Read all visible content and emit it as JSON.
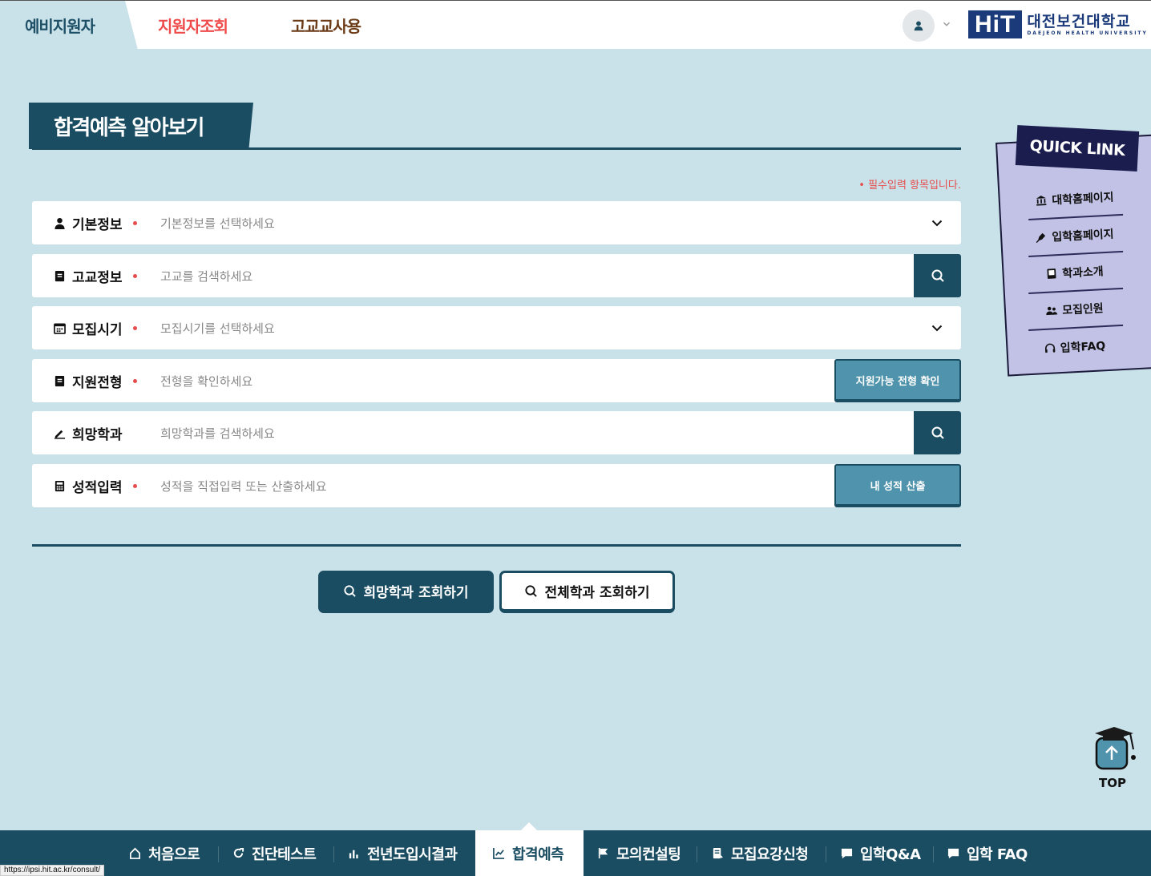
{
  "topnav": {
    "tabs": [
      {
        "label": "예비지원자"
      },
      {
        "label": "지원자조회"
      },
      {
        "label": "고교교사용"
      }
    ],
    "logo": {
      "box": "HiT",
      "ko": "대전보건대학교",
      "en": "DAEJEON HEALTH UNIVERSITY"
    }
  },
  "page": {
    "title": "합격예측 알아보기",
    "required_note": "• 필수입력 항목입니다."
  },
  "form": {
    "rows": [
      {
        "label": "기본정보",
        "placeholder": "기본정보를 선택하세요",
        "icon": "user-icon",
        "required": true
      },
      {
        "label": "고교정보",
        "placeholder": "고교를 검색하세요",
        "icon": "book-icon",
        "required": true
      },
      {
        "label": "모집시기",
        "placeholder": "모집시기를 선택하세요",
        "icon": "calendar-icon",
        "required": true
      },
      {
        "label": "지원전형",
        "placeholder": "전형을 확인하세요",
        "icon": "book-icon",
        "required": true,
        "button": "지원가능 전형 확인"
      },
      {
        "label": "희망학과",
        "placeholder": "희망학과를 검색하세요",
        "icon": "pencil-icon",
        "required": false
      },
      {
        "label": "성적입력",
        "placeholder": "성적을 직접입력 또는 산출하세요",
        "icon": "calculator-icon",
        "required": true,
        "button": "내 성적 산출"
      }
    ]
  },
  "actions": {
    "search_desired": "희망학과 조회하기",
    "search_all": "전체학과 조회하기"
  },
  "quicklink": {
    "title": "QUICK LINK",
    "items": [
      {
        "label": "대학홈페이지",
        "icon": "university-icon"
      },
      {
        "label": "입학홈페이지",
        "icon": "pen-nib-icon"
      },
      {
        "label": "학과소개",
        "icon": "book-icon"
      },
      {
        "label": "모집인원",
        "icon": "users-icon"
      },
      {
        "label": "입학FAQ",
        "icon": "headset-icon"
      }
    ]
  },
  "top_button": {
    "label": "TOP"
  },
  "bottomnav": {
    "items": [
      {
        "label": "처음으로",
        "icon": "home-icon"
      },
      {
        "label": "진단테스트",
        "icon": "refresh-icon"
      },
      {
        "label": "전년도입시결과",
        "icon": "bar-chart-icon"
      },
      {
        "label": "합격예측",
        "icon": "line-chart-icon",
        "active": true
      },
      {
        "label": "모의컨설팅",
        "icon": "flag-icon"
      },
      {
        "label": "모집요강신청",
        "icon": "document-icon"
      },
      {
        "label": "입학Q&A",
        "icon": "chat-icon"
      },
      {
        "label": "입학 FAQ",
        "icon": "chat-icon"
      }
    ]
  },
  "status_url": "https://ipsi.hit.ac.kr/consult/",
  "colors": {
    "primary": "#1a4d62",
    "accent_red": "#ef4b4b",
    "background": "#c9e1e9",
    "quicklink_bg": "#c2c2e6",
    "button_blue": "#4f93ac"
  }
}
